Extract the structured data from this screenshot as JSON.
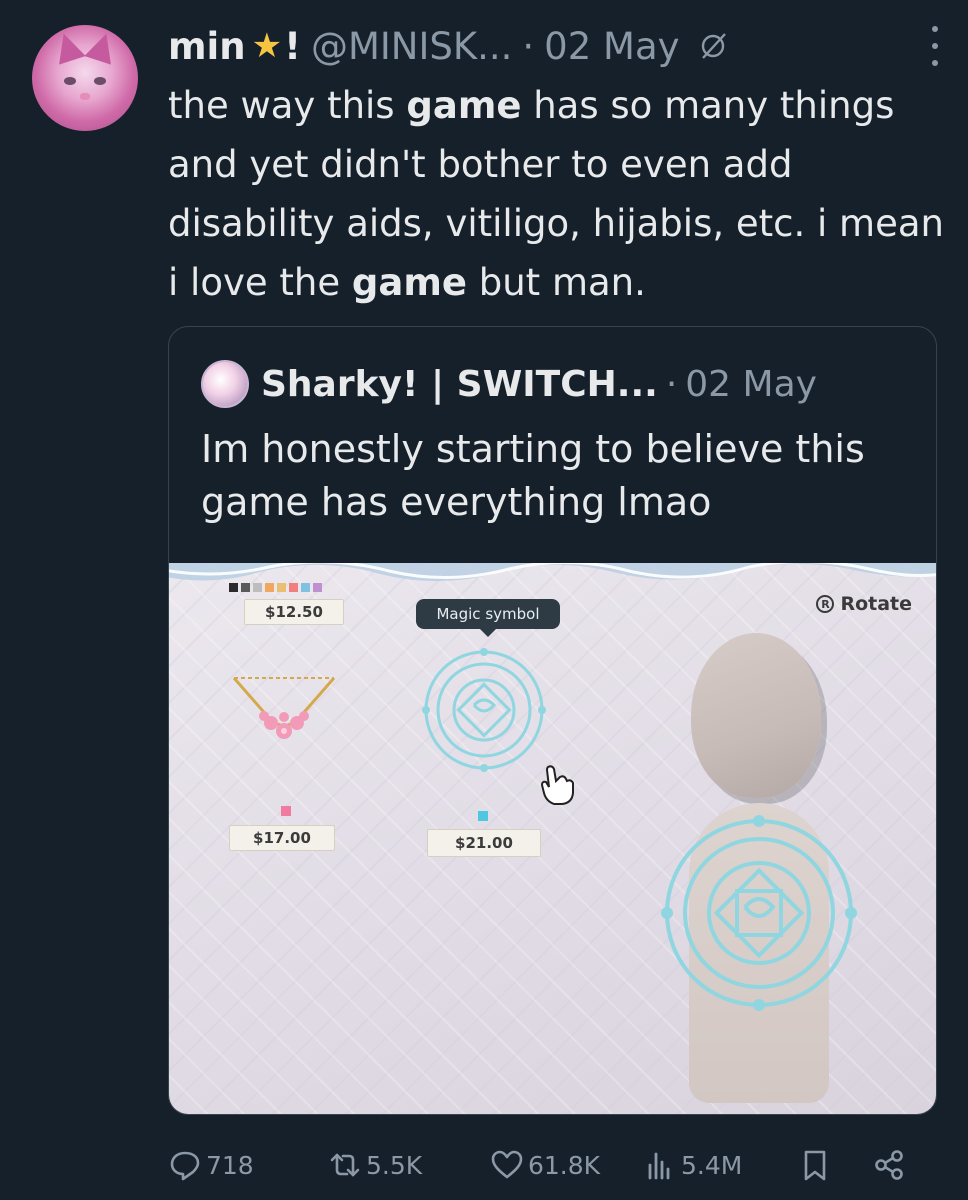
{
  "tweet": {
    "display_name": "min",
    "name_suffix": "!",
    "handle": "@MINISK...",
    "separator": "·",
    "date": "02 May",
    "text_parts": [
      "the way this ",
      "game",
      " has so many things and yet didn't bother to even add disability aids, vitiligo, hijabis, etc. i mean i love the ",
      "game",
      " but man."
    ]
  },
  "quote": {
    "display_name": "Sharky! | SWITCH...",
    "separator": "·",
    "date": "02 May",
    "text": "Im honestly starting to believe this game has everything lmao",
    "media": {
      "prices": [
        "$12.50",
        "$17.00",
        "$21.00"
      ],
      "tooltip": "Magic symbol",
      "rotate_button_key": "R",
      "rotate_label": "Rotate"
    }
  },
  "actions": {
    "replies": "718",
    "reposts": "5.5K",
    "likes": "61.8K",
    "views": "5.4M"
  },
  "colors": {
    "background": "#15202b",
    "text_primary": "#e7e9ea",
    "text_secondary": "#8b98a5",
    "border": "#38444d",
    "star": "#f5c542"
  }
}
